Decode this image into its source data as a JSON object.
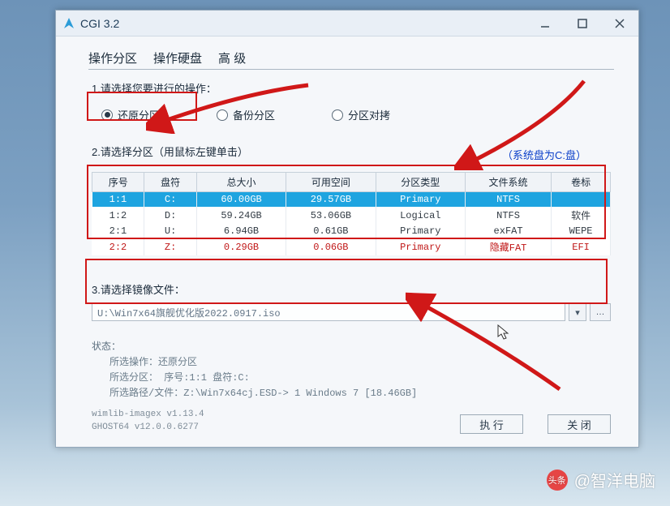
{
  "window": {
    "title": "CGI 3.2"
  },
  "menu": {
    "partition": "操作分区",
    "disk": "操作硬盘",
    "advanced": "高 级"
  },
  "step1": {
    "label": "1.请选择您要进行的操作：",
    "opt_restore": "还原分区",
    "opt_backup": "备份分区",
    "opt_copy": "分区对拷"
  },
  "step2": {
    "label": "2.请选择分区（用鼠标左键单击）",
    "sysdisk": "（系统盘为C:盘）",
    "cols": {
      "idx": "序号",
      "drv": "盘符",
      "total": "总大小",
      "free": "可用空间",
      "ptype": "分区类型",
      "fs": "文件系统",
      "vol": "卷标"
    },
    "rows": [
      {
        "idx": "1:1",
        "drv": "C:",
        "total": "60.00GB",
        "free": "29.57GB",
        "ptype": "Primary",
        "fs": "NTFS",
        "vol": ""
      },
      {
        "idx": "1:2",
        "drv": "D:",
        "total": "59.24GB",
        "free": "53.06GB",
        "ptype": "Logical",
        "fs": "NTFS",
        "vol": "软件"
      },
      {
        "idx": "2:1",
        "drv": "U:",
        "total": "6.94GB",
        "free": "0.61GB",
        "ptype": "Primary",
        "fs": "exFAT",
        "vol": "WEPE"
      },
      {
        "idx": "2:2",
        "drv": "Z:",
        "total": "0.29GB",
        "free": "0.06GB",
        "ptype": "Primary",
        "fs": "隐藏FAT",
        "vol": "EFI"
      }
    ]
  },
  "step3": {
    "label": "3.请选择镜像文件：",
    "path": "U:\\Win7x64旗舰优化版2022.0917.iso"
  },
  "status": {
    "header": "状态：",
    "op": "所选操作：还原分区",
    "part": "所选分区：  序号:1:1        盘符:C:",
    "file": "所选路径/文件：Z:\\Win7x64cj.ESD-> 1  Windows 7  [18.46GB]"
  },
  "version": {
    "l1": "wimlib-imagex v1.13.4",
    "l2": "GHOST64 v12.0.0.6277"
  },
  "buttons": {
    "exec": "执 行",
    "close": "关 闭"
  },
  "watermark": "@智洋电脑"
}
